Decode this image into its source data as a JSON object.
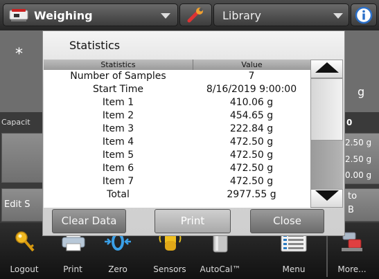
{
  "topbar": {
    "app_label": "Weighing",
    "library_label": "Library"
  },
  "background": {
    "asterisk": "*",
    "unit": "g",
    "capacity_label": "Capacit",
    "capacity_value": "0",
    "side_values": [
      "2.50 g",
      "2.50 g",
      "0.00 g"
    ],
    "edit_label": "Edit S",
    "to_label": "to",
    "b_label": "B"
  },
  "dialog": {
    "title": "Statistics",
    "col_statistics": "Statistics",
    "col_value": "Value",
    "rows": [
      {
        "name": "Number of Samples",
        "value": "7"
      },
      {
        "name": "Start Time",
        "value": "8/16/2019 9:00:00"
      },
      {
        "name": "Item 1",
        "value": "410.06 g"
      },
      {
        "name": "Item 2",
        "value": "454.65 g"
      },
      {
        "name": "Item 3",
        "value": "222.84 g"
      },
      {
        "name": "Item 4",
        "value": "472.50 g"
      },
      {
        "name": "Item 5",
        "value": "472.50 g"
      },
      {
        "name": "Item 6",
        "value": "472.50 g"
      },
      {
        "name": "Item 7",
        "value": "472.50 g"
      },
      {
        "name": "Total",
        "value": "2977.55 g"
      }
    ],
    "buttons": {
      "clear": "Clear Data",
      "print": "Print",
      "close": "Close"
    }
  },
  "bottombar": {
    "items": [
      {
        "label": "Logout",
        "icon": "key-icon"
      },
      {
        "label": "Print",
        "icon": "printer-icon"
      },
      {
        "label": "Zero",
        "icon": "zero-icon"
      },
      {
        "label": "Sensors",
        "icon": "hand-sensor-icon"
      },
      {
        "label": "AutoCal™",
        "icon": "weight-icon"
      },
      {
        "label": "Menu",
        "icon": "menu-list-icon"
      },
      {
        "label": "More...",
        "icon": "more-icon"
      }
    ]
  }
}
